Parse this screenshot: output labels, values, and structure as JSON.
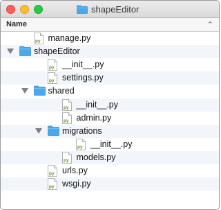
{
  "window": {
    "title": "shapeEditor"
  },
  "header": {
    "name_column": "Name",
    "sort_icon": "chevron-up-icon"
  },
  "rows": [
    {
      "label": "manage.py",
      "type": "py-file",
      "depth": 1
    },
    {
      "label": "shapeEditor",
      "type": "folder",
      "depth": 0,
      "expanded": true
    },
    {
      "label": "__init__.py",
      "type": "py-file",
      "depth": 2
    },
    {
      "label": "settings.py",
      "type": "py-file",
      "depth": 2
    },
    {
      "label": "shared",
      "type": "folder",
      "depth": 1,
      "expanded": true
    },
    {
      "label": "__init__.py",
      "type": "py-file",
      "depth": 3
    },
    {
      "label": "admin.py",
      "type": "py-file",
      "depth": 3
    },
    {
      "label": "migrations",
      "type": "folder",
      "depth": 2,
      "expanded": true
    },
    {
      "label": "__init__.py",
      "type": "py-file",
      "depth": 4
    },
    {
      "label": "models.py",
      "type": "py-file",
      "depth": 3
    },
    {
      "label": "urls.py",
      "type": "py-file",
      "depth": 2
    },
    {
      "label": "wsgi.py",
      "type": "py-file",
      "depth": 2
    }
  ],
  "colors": {
    "folder": "#4aa9ec",
    "row_alt": "#f2f5fa",
    "py_badge": "#6b8e23"
  }
}
